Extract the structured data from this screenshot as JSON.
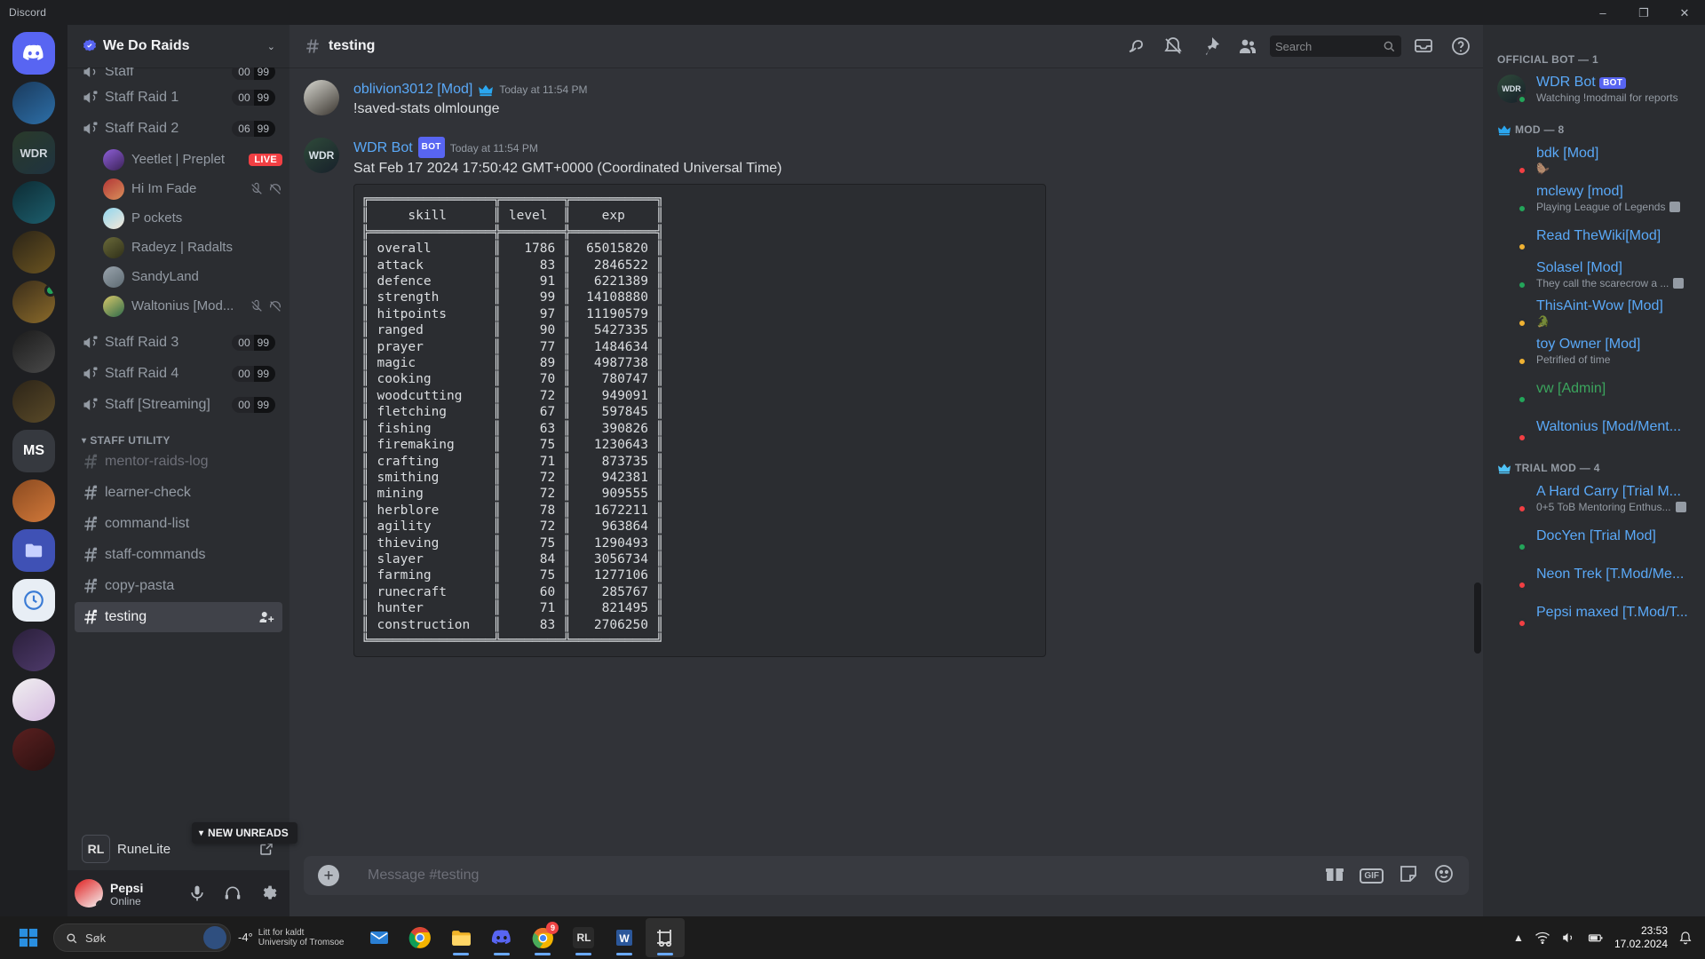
{
  "window": {
    "title": "Discord",
    "minimize": "–",
    "maximize": "❐",
    "close": "✕"
  },
  "server": {
    "name": "We Do Raids",
    "badge_icon": "verified-server-icon",
    "chevron": "⌄"
  },
  "channels": {
    "items": [
      {
        "type": "voice",
        "name": "Staff",
        "count_a": "00",
        "count_b": "99",
        "partial": true
      },
      {
        "type": "voice",
        "name": "Staff Raid 1",
        "count_a": "00",
        "count_b": "99"
      },
      {
        "type": "voice",
        "name": "Staff Raid 2",
        "count_a": "06",
        "count_b": "99"
      },
      {
        "type": "voice",
        "name": "Staff Raid 3",
        "count_a": "00",
        "count_b": "99"
      },
      {
        "type": "voice",
        "name": "Staff Raid 4",
        "count_a": "00",
        "count_b": "99"
      },
      {
        "type": "voice",
        "name": "Staff [Streaming]",
        "count_a": "00",
        "count_b": "99"
      }
    ],
    "voice_users": [
      {
        "name": "Yeetlet | Preplet",
        "live": "LIVE",
        "avatar": "purple"
      },
      {
        "name": "Hi Im Fade",
        "muted": true,
        "deafened": true,
        "avatar": "red"
      },
      {
        "name": "P ockets",
        "avatar": "blue"
      },
      {
        "name": "Radeyz | Radalts",
        "avatar": "olive"
      },
      {
        "name": "SandyLand",
        "avatar": "grey"
      },
      {
        "name": "Waltonius [Mod...",
        "muted": true,
        "deafened": true,
        "avatar": "green"
      }
    ],
    "category": "STAFF UTILITY",
    "text_channels": [
      {
        "name": "mentor-raids-log",
        "locked": true,
        "muted": true
      },
      {
        "name": "learner-check",
        "locked": true
      },
      {
        "name": "command-list",
        "locked": true
      },
      {
        "name": "staff-commands",
        "locked": true
      },
      {
        "name": "copy-pasta",
        "locked": true
      },
      {
        "name": "testing",
        "locked": true,
        "active": true
      }
    ],
    "new_unreads": "NEW UNREADS",
    "activity": {
      "label": "RuneLite",
      "icon_text": "RL"
    }
  },
  "user_panel": {
    "name": "Pepsi",
    "status": "Online",
    "mic_icon": "microphone-icon",
    "headset_icon": "headphones-icon",
    "settings_icon": "gear-icon"
  },
  "chat_header": {
    "hash": "#",
    "channel": "testing",
    "icons": [
      "threads-icon",
      "notification-off-icon",
      "pin-icon",
      "members-icon",
      "inbox-icon",
      "help-icon"
    ]
  },
  "search": {
    "placeholder": "Search",
    "value": ""
  },
  "messages": [
    {
      "author": "oblivion3012 [Mod]",
      "badge": "crown-icon",
      "timestamp": "Today at 11:54 PM",
      "text": "!saved-stats olmlounge",
      "avatar": "grey"
    },
    {
      "author": "WDR Bot",
      "bot_tag": "BOT",
      "timestamp": "Today at 11:54 PM",
      "text": "Sat Feb 17 2024 17:50:42 GMT+0000 (Coordinated Universal Time)",
      "avatar": "wdr"
    }
  ],
  "stats_table": {
    "headers": [
      "skill",
      "level",
      "exp"
    ],
    "rows": [
      [
        "overall",
        "1786",
        "65015820"
      ],
      [
        "attack",
        "83",
        "2846522"
      ],
      [
        "defence",
        "91",
        "6221389"
      ],
      [
        "strength",
        "99",
        "14108880"
      ],
      [
        "hitpoints",
        "97",
        "11190579"
      ],
      [
        "ranged",
        "90",
        "5427335"
      ],
      [
        "prayer",
        "77",
        "1484634"
      ],
      [
        "magic",
        "89",
        "4987738"
      ],
      [
        "cooking",
        "70",
        "780747"
      ],
      [
        "woodcutting",
        "72",
        "949091"
      ],
      [
        "fletching",
        "67",
        "597845"
      ],
      [
        "fishing",
        "63",
        "390826"
      ],
      [
        "firemaking",
        "75",
        "1230643"
      ],
      [
        "crafting",
        "71",
        "873735"
      ],
      [
        "smithing",
        "72",
        "942381"
      ],
      [
        "mining",
        "72",
        "909555"
      ],
      [
        "herblore",
        "78",
        "1672211"
      ],
      [
        "agility",
        "72",
        "963864"
      ],
      [
        "thieving",
        "75",
        "1290493"
      ],
      [
        "slayer",
        "84",
        "3056734"
      ],
      [
        "farming",
        "75",
        "1277106"
      ],
      [
        "runecraft",
        "60",
        "285767"
      ],
      [
        "hunter",
        "71",
        "821495"
      ],
      [
        "construction",
        "83",
        "2706250"
      ]
    ]
  },
  "composer": {
    "placeholder": "Message #testing",
    "gif_label": "GIF",
    "icons": [
      "gift-icon",
      "gif-icon",
      "sticker-icon",
      "emoji-icon"
    ]
  },
  "members": {
    "groups": [
      {
        "title": "OFFICIAL BOT — 1",
        "crown": false,
        "items": [
          {
            "name": "WDR Bot",
            "bot": "BOT",
            "sub": "Watching !modmail for reports",
            "status": "online",
            "color": "mod",
            "avatar": "wdr"
          }
        ]
      },
      {
        "title": "MOD — 8",
        "crown": true,
        "items": [
          {
            "name": "bdk [Mod]",
            "sub": "🦫",
            "status": "dnd",
            "color": "mod",
            "avatar": "bdk"
          },
          {
            "name": "mclewy [mod]",
            "sub": "Playing League of Legends",
            "sub_icon": true,
            "status": "online",
            "color": "mod",
            "avatar": "pink"
          },
          {
            "name": "Read TheWiki[Mod]",
            "sub": "",
            "status": "idle",
            "color": "mod",
            "avatar": "cap"
          },
          {
            "name": "Solasel [Mod]",
            "sub": "They call the scarecrow a ...",
            "sub_icon": true,
            "status": "online",
            "color": "mod",
            "avatar": "rose"
          },
          {
            "name": "ThisAint-Wow [Mod]",
            "sub": "🐊",
            "status": "idle",
            "color": "mod",
            "avatar": "yellow"
          },
          {
            "name": "toy Owner [Mod]",
            "sub": "Petrified of time",
            "status": "idle",
            "color": "mod",
            "avatar": "orange"
          },
          {
            "name": "vw [Admin]",
            "sub": "",
            "status": "online",
            "color": "admin",
            "avatar": "fire"
          },
          {
            "name": "Waltonius [Mod/Ment...",
            "sub": "",
            "status": "dnd",
            "color": "mod",
            "avatar": "green"
          }
        ]
      },
      {
        "title": "TRIAL MOD — 4",
        "crown": true,
        "items": [
          {
            "name": "A Hard Carry [Trial M...",
            "sub": "0+5 ToB Mentoring Enthus...",
            "sub_icon": true,
            "status": "dnd",
            "color": "mod",
            "avatar": "lamp"
          },
          {
            "name": "DocYen [Trial Mod]",
            "sub": "",
            "status": "online",
            "color": "mod",
            "avatar": "teal"
          },
          {
            "name": "Neon Trek [T.Mod/Me...",
            "sub": "",
            "status": "dnd",
            "color": "mod",
            "avatar": "darkgreen"
          },
          {
            "name": "Pepsi maxed [T.Mod/T...",
            "sub": "",
            "status": "dnd",
            "color": "mod",
            "avatar": "cola"
          }
        ]
      }
    ]
  },
  "taskbar": {
    "search_placeholder": "Søk",
    "weather": {
      "temp": "-4°",
      "line1": "Litt for kaldt",
      "line2": "University of Tromsoe"
    },
    "apps": [
      {
        "name": "mail-app",
        "badge": ""
      },
      {
        "name": "chrome-app",
        "badge": ""
      },
      {
        "name": "file-explorer-app",
        "badge": ""
      },
      {
        "name": "discord-app",
        "badge": ""
      },
      {
        "name": "chrome-canary-app",
        "badge": "9"
      },
      {
        "name": "runelite-app",
        "badge": ""
      },
      {
        "name": "word-app",
        "badge": ""
      },
      {
        "name": "snipping-tool-app",
        "badge": ""
      }
    ],
    "clock": {
      "time": "23:53",
      "date": "17.02.2024"
    }
  }
}
